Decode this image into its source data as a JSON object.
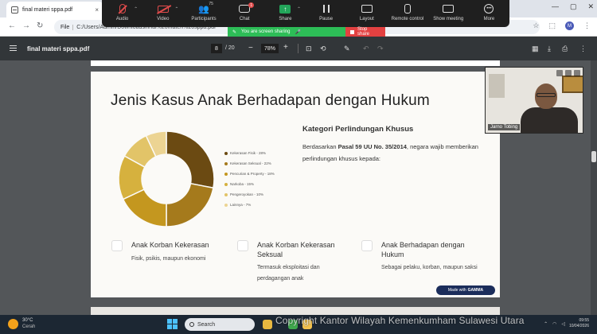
{
  "browser": {
    "tab_title": "final materi sppa.pdf",
    "tab_close": "×",
    "address_chip": "File",
    "address_url": "C:/Users/Admin/Downloads/final%20materi%20sppa.pdf",
    "window_controls": [
      "—",
      "▢",
      "✕"
    ],
    "profile_initial": "M"
  },
  "zoom": {
    "buttons": [
      {
        "label": "Audio",
        "icon": "mic-muted-icon"
      },
      {
        "label": "Video",
        "icon": "video-off-icon"
      },
      {
        "label": "Participants",
        "icon": "participants-icon",
        "count": "75"
      },
      {
        "label": "Chat",
        "icon": "chat-icon",
        "badge": "1"
      },
      {
        "label": "Share",
        "icon": "share-screen-icon"
      },
      {
        "label": "Pause",
        "icon": "pause-icon"
      },
      {
        "label": "Layout",
        "icon": "layout-icon"
      },
      {
        "label": "Remote control",
        "icon": "remote-control-icon"
      },
      {
        "label": "Show meeting",
        "icon": "show-meeting-icon"
      },
      {
        "label": "More",
        "icon": "more-icon"
      }
    ],
    "sharing_text": "You are screen sharing",
    "stop_share": "Stop share",
    "accent_green": "#2dbd57",
    "accent_red": "#e34141"
  },
  "pdf": {
    "title": "final materi sppa.pdf",
    "page_current": "8",
    "page_total": "/ 20",
    "zoom_level": "78%"
  },
  "slide": {
    "title": "Jenis Kasus Anak Berhadapan dengan Hukum",
    "legend": [
      {
        "label": "Kekerasan Fisik - 28%",
        "value": 28,
        "color": "#6b4a12"
      },
      {
        "label": "Kekerasan Seksual - 22%",
        "value": 22,
        "color": "#a57a1c"
      },
      {
        "label": "Pencurian & Property - 18%",
        "value": 18,
        "color": "#c4971f"
      },
      {
        "label": "Narkoba - 15%",
        "value": 15,
        "color": "#d6b13e"
      },
      {
        "label": "Pengeroyokan - 10%",
        "value": 10,
        "color": "#e2c468"
      },
      {
        "label": "Lainnya - 7%",
        "value": 7,
        "color": "#ecd493"
      }
    ],
    "kategori_title": "Kategori Perlindungan Khusus",
    "kategori_prefix": "Berdasarkan ",
    "kategori_bold": "Pasal 59 UU No. 35/2014",
    "kategori_suffix": ", negara wajib memberikan perlindungan khusus kepada:",
    "cards": [
      {
        "title": "Anak Korban Kekerasan",
        "desc": "Fisik, psikis, maupun ekonomi"
      },
      {
        "title": "Anak Korban Kekerasan Seksual",
        "desc": "Termasuk eksploitasi dan perdagangan anak"
      },
      {
        "title": "Anak Berhadapan dengan Hukum",
        "desc": "Sebagai pelaku, korban, maupun saksi"
      }
    ],
    "made_with_prefix": "Made with",
    "made_with_brand": "GAMMA"
  },
  "participant": {
    "name": "Jarno Tobing"
  },
  "taskbar": {
    "weather_temp": "30°C",
    "weather_desc": "Cerah",
    "search_label": "Search",
    "time": "09:55",
    "date": "10/04/2026"
  },
  "watermark": "Copyright Kantor Wilayah Kemenkumham Sulawesi Utara"
}
